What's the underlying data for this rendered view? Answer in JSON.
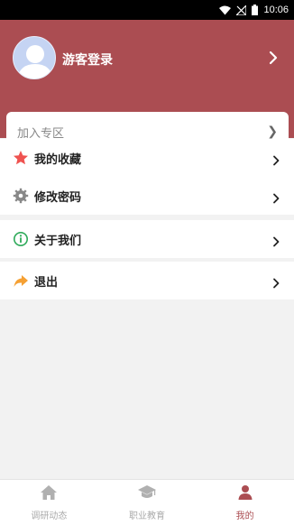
{
  "status_bar": {
    "time": "10:06"
  },
  "profile": {
    "name": "游客登录"
  },
  "join": {
    "placeholder": "加入专区",
    "arrow": "❯"
  },
  "menu": {
    "favorites": "我的收藏",
    "change_password": "修改密码",
    "about": "关于我们",
    "logout": "退出"
  },
  "bottom_nav": {
    "tabs": [
      {
        "label": "调研动态",
        "icon": "home-icon"
      },
      {
        "label": "职业教育",
        "icon": "graduation-cap-icon"
      },
      {
        "label": "我的",
        "icon": "person-icon",
        "active": true
      }
    ]
  },
  "colors": {
    "header": "#ab4d52",
    "accent": "#ab4d52",
    "star": "#ef5350",
    "info": "#2eaa5a",
    "logout": "#f5a033"
  }
}
